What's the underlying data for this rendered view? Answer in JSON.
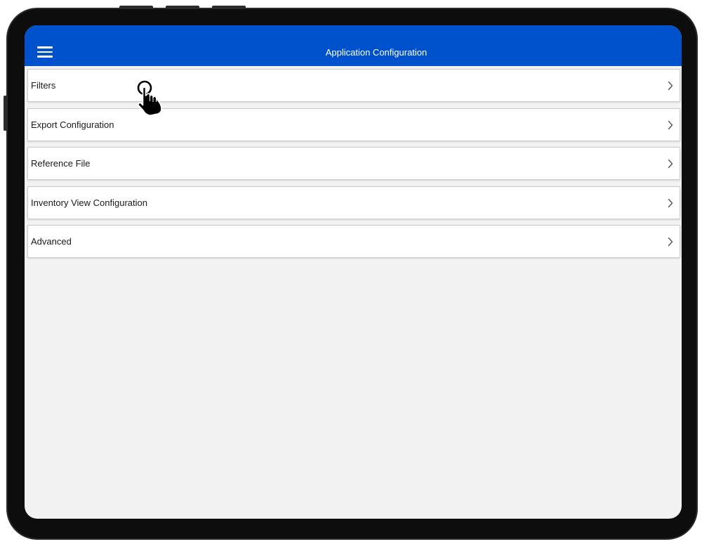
{
  "header": {
    "title": "Application Configuration",
    "menu_icon": "hamburger-menu-icon",
    "color": "#0052cc"
  },
  "menu": {
    "items": [
      {
        "label": "Filters",
        "icon": "chevron-right-icon"
      },
      {
        "label": "Export Configuration",
        "icon": "chevron-right-icon"
      },
      {
        "label": "Reference File",
        "icon": "chevron-right-icon"
      },
      {
        "label": "Inventory View Configuration",
        "icon": "chevron-right-icon"
      },
      {
        "label": "Advanced",
        "icon": "chevron-right-icon"
      }
    ]
  },
  "overlay": {
    "cursor_icon": "hand-pointer-icon"
  },
  "colors": {
    "background": "#f2f2f2",
    "item_background": "#ffffff",
    "item_border": "#c9c9c9",
    "device_frame": "#0d0d0d"
  }
}
